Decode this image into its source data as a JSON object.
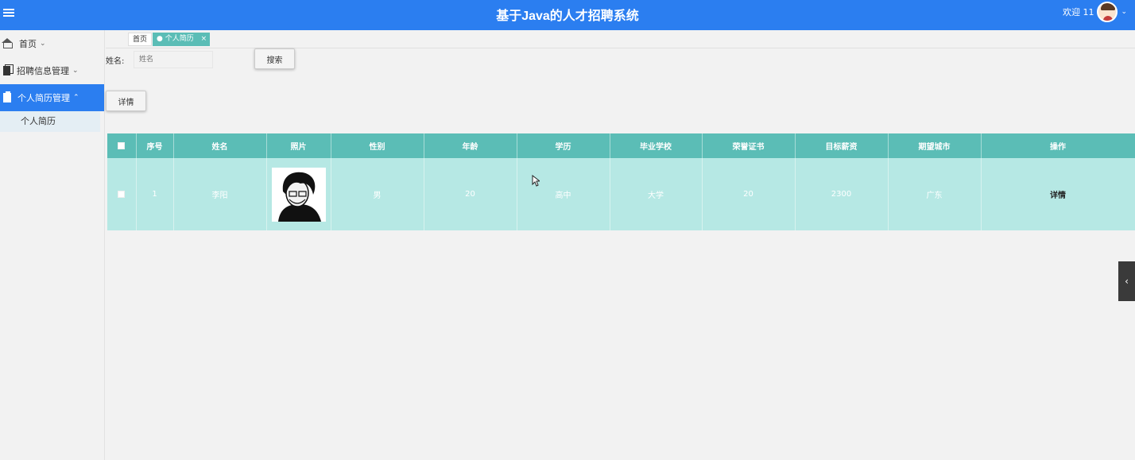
{
  "header": {
    "title": "基于Java的人才招聘系统",
    "welcome": "欢迎 11"
  },
  "sidebar": {
    "items": [
      {
        "label": "首页"
      },
      {
        "label": "招聘信息管理"
      },
      {
        "label": "个人简历管理"
      }
    ],
    "sub_items": [
      {
        "label": "个人简历"
      }
    ]
  },
  "tabs": {
    "home": "首页",
    "active": "● 个人简历",
    "close": "×"
  },
  "search": {
    "label": "姓名:",
    "placeholder": "姓名",
    "button": "搜索"
  },
  "toolbar": {
    "detail_button": "详情"
  },
  "table": {
    "headers": [
      "序号",
      "姓名",
      "照片",
      "性别",
      "年龄",
      "学历",
      "毕业学校",
      "荣誉证书",
      "目标薪资",
      "期望城市",
      "操作"
    ],
    "rows": [
      {
        "index": "1",
        "name": "李阳",
        "gender": "男",
        "age": "20",
        "education": "高中",
        "school": "大学",
        "certificates": "20",
        "salary": "2300",
        "city": "广东",
        "action": "详情"
      }
    ]
  },
  "colors": {
    "topbar": "#2b7ef0",
    "table_header": "#5bbdb6",
    "table_row": "#b6e8e4"
  }
}
